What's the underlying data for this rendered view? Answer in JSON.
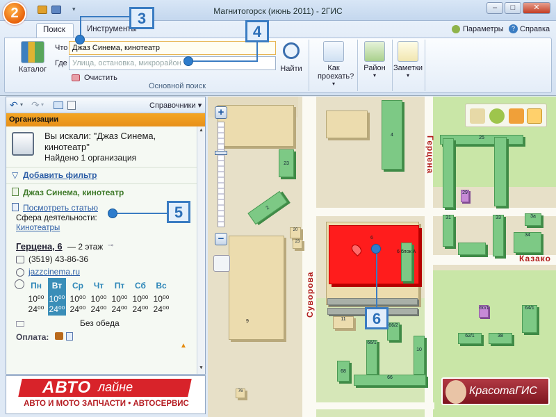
{
  "window": {
    "title": "Магнитогорск (июнь 2011) - 2ГИС",
    "logo_text": "2"
  },
  "ribbon": {
    "tabs": [
      "Поиск",
      "Инструменты"
    ],
    "right_links": {
      "settings": "Параметры",
      "help": "Справка"
    },
    "catalog_label": "Каталог",
    "what_label": "Что",
    "where_label": "Где",
    "what_value": "Джаз Синема, кинотеатр",
    "where_placeholder": "Улица, остановка, микрорайон",
    "clear_label": "Очистить",
    "find_label": "Найти",
    "route_label": "Как проехать?",
    "district_label": "Район",
    "notes_label": "Заметки",
    "group_label": "Основной поиск"
  },
  "callouts": {
    "c3": "3",
    "c4": "4",
    "c5": "5",
    "c6": "6"
  },
  "left_panel": {
    "directories": "Справочники",
    "header": "Организации",
    "search_result": "Вы искали: \"Джаз Синема, кинотеатр\"",
    "found": "Найдено 1 организация",
    "add_filter": "Добавить фильтр",
    "org_name": "Джаз Синема, кинотеатр",
    "view_article": "Посмотреть статью",
    "activity_label": "Сфера деятельности:",
    "activity_value": "Кинотеатры",
    "address": "Герцена, 6",
    "floor": "— 2 этаж",
    "phone": "(3519) 43-86-36",
    "website": "jazzcinema.ru",
    "days": [
      "Пн",
      "Вт",
      "Ср",
      "Чт",
      "Пт",
      "Сб",
      "Вс"
    ],
    "open": "10⁰⁰",
    "close": "24⁰⁰",
    "no_break": "Без обеда",
    "payment": "Оплата:"
  },
  "banner": {
    "brand": "АВТО",
    "brand2": "лайне",
    "tagline": "АВТО И МОТО ЗАПЧАСТИ • АВТОСЕРВИС"
  },
  "map": {
    "streets": {
      "suvorova": "Суворова",
      "gercena": "Герцена",
      "kazakova": "Казако"
    },
    "buildings": [
      "4",
      "25",
      "23",
      "23а",
      "2",
      "20",
      "23",
      "6",
      "6 блок А",
      "11",
      "66/2",
      "66/1",
      "10",
      "68",
      "66",
      "76",
      "9",
      "29",
      "31",
      "3а",
      "33",
      "34",
      "35/1",
      "60/1",
      "64/1",
      "62/1",
      "38"
    ],
    "ad_label": "КрасотаГИС",
    "colors": {
      "highlight": "#ff1c1c",
      "building": "#7dc985",
      "street": "#b11a1a"
    }
  }
}
